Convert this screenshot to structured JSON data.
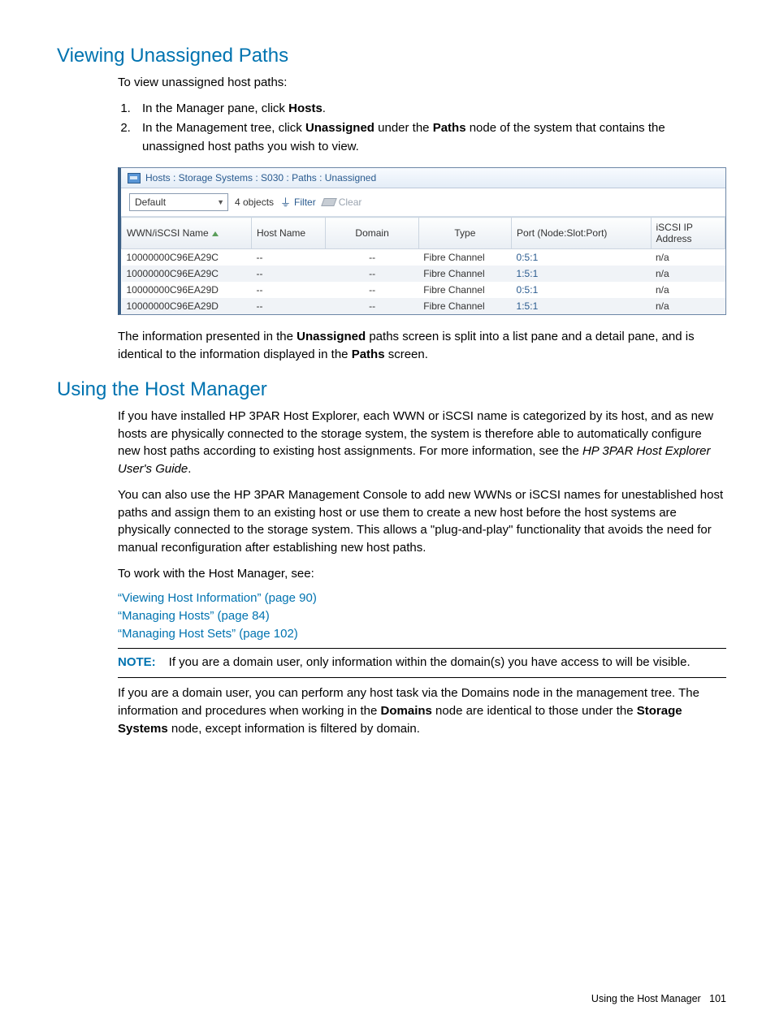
{
  "section1": {
    "heading": "Viewing Unassigned Paths",
    "intro": "To view unassigned host paths:",
    "step1_a": "In the Manager pane, click ",
    "step1_b": "Hosts",
    "step1_c": ".",
    "step2_a": "In the Management tree, click ",
    "step2_b": "Unassigned",
    "step2_c": " under the ",
    "step2_d": "Paths",
    "step2_e": " node of the system that contains the unassigned host paths you wish to view.",
    "outro_a": "The information presented in the ",
    "outro_b": "Unassigned",
    "outro_c": " paths screen is split into a list pane and a detail pane, and is identical to the information displayed in the ",
    "outro_d": "Paths",
    "outro_e": " screen."
  },
  "panel": {
    "title": "Hosts : Storage Systems : S030 : Paths : Unassigned",
    "select_value": "Default",
    "object_count": "4 objects",
    "filter_label": "Filter",
    "clear_label": "Clear",
    "columns": {
      "wwn": "WWN/iSCSI Name",
      "host": "Host Name",
      "domain": "Domain",
      "type": "Type",
      "port": "Port (Node:Slot:Port)",
      "iscsi": "iSCSI IP Address"
    },
    "rows": [
      {
        "wwn": "10000000C96EA29C",
        "host": "--",
        "domain": "--",
        "type": "Fibre Channel",
        "port": "0:5:1",
        "iscsi": "n/a"
      },
      {
        "wwn": "10000000C96EA29C",
        "host": "--",
        "domain": "--",
        "type": "Fibre Channel",
        "port": "1:5:1",
        "iscsi": "n/a"
      },
      {
        "wwn": "10000000C96EA29D",
        "host": "--",
        "domain": "--",
        "type": "Fibre Channel",
        "port": "0:5:1",
        "iscsi": "n/a"
      },
      {
        "wwn": "10000000C96EA29D",
        "host": "--",
        "domain": "--",
        "type": "Fibre Channel",
        "port": "1:5:1",
        "iscsi": "n/a"
      }
    ]
  },
  "section2": {
    "heading": "Using the Host Manager",
    "p1": "If you have installed HP 3PAR Host Explorer, each WWN or iSCSI name is categorized by its host, and as new hosts are physically connected to the storage system, the system is therefore able to automatically configure new host paths according to existing host assignments. For more information, see the ",
    "p1_i": "HP 3PAR Host Explorer User's Guide",
    "p1_end": ".",
    "p2": "You can also use the HP 3PAR Management Console to add new WWNs or iSCSI names for unestablished host paths and assign them to an existing host or use them to create a new host before the host systems are physically connected to the storage system. This allows a \"plug-and-play\" functionality that avoids the need for manual reconfiguration after establishing new host paths.",
    "p3": "To work with the Host Manager, see:",
    "link1": "“Viewing Host Information” (page 90)",
    "link2": "“Managing Hosts” (page 84)",
    "link3": "“Managing Host Sets” (page 102)",
    "note_label": "NOTE:",
    "note_body": "If you are a domain user, only information within the domain(s) you have access to will be visible.",
    "p4_a": "If you are a domain user, you can perform any host task via the Domains node in the management tree. The information and procedures when working in the ",
    "p4_b": "Domains",
    "p4_c": " node are identical to those under the ",
    "p4_d": "Storage Systems",
    "p4_e": " node, except information is filtered by domain."
  },
  "footer": {
    "text": "Using the Host Manager",
    "page": "101"
  }
}
